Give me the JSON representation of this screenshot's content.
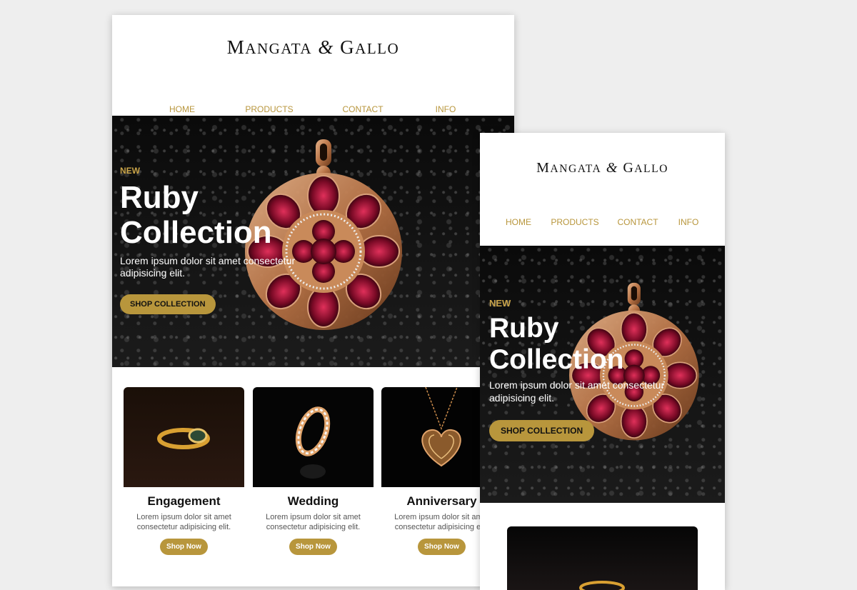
{
  "brand": {
    "first": "Mangata",
    "amp": "&",
    "second": "Gallo"
  },
  "nav": [
    {
      "label": "HOME"
    },
    {
      "label": "PRODUCTS"
    },
    {
      "label": "CONTACT"
    },
    {
      "label": "INFO"
    }
  ],
  "hero": {
    "eyebrow": "NEW",
    "headline": "Ruby Collection",
    "subtext": "Lorem ipsum dolor sit amet consectetur adipisicing elit.",
    "cta": "SHOP COLLECTION"
  },
  "products": [
    {
      "title": "Engagement",
      "desc_line1": "Lorem ipsum dolor sit amet",
      "desc_line2": "consectetur adipisicing elit.",
      "cta": "Shop Now",
      "icon": "ring-icon"
    },
    {
      "title": "Wedding",
      "desc_line1": "Lorem ipsum dolor sit amet",
      "desc_line2": "consectetur adipisicing elit.",
      "cta": "Shop Now",
      "icon": "band-icon"
    },
    {
      "title": "Anniversary",
      "desc_line1": "Lorem ipsum dolor sit amet",
      "desc_line2": "consectetur adipisicing elit.",
      "cta": "Shop Now",
      "icon": "heart-pendant-icon"
    }
  ],
  "colors": {
    "accent": "#b8963c",
    "background": "#eeeeee",
    "hero_dark": "#0a0a0a"
  }
}
